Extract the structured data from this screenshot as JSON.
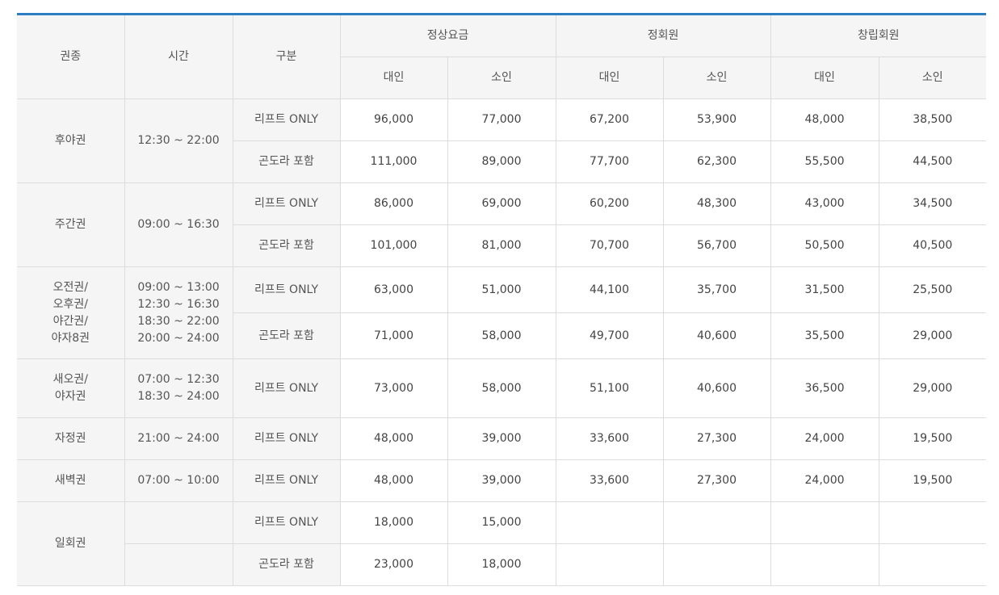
{
  "header": {
    "ticket": "권종",
    "time": "시간",
    "type": "구분",
    "groups": [
      "정상요금",
      "정회원",
      "창립회원"
    ],
    "adult": "대인",
    "child": "소인"
  },
  "rows": [
    {
      "ticket": "후야권",
      "time": "12:30 ~ 22:00",
      "type": "리프트 ONLY",
      "prices": [
        "96,000",
        "77,000",
        "67,200",
        "53,900",
        "48,000",
        "38,500"
      ]
    },
    {
      "type": "곤도라 포함",
      "prices": [
        "111,000",
        "89,000",
        "77,700",
        "62,300",
        "55,500",
        "44,500"
      ]
    },
    {
      "ticket": "주간권",
      "time": "09:00 ~ 16:30",
      "type": "리프트 ONLY",
      "prices": [
        "86,000",
        "69,000",
        "60,200",
        "48,300",
        "43,000",
        "34,500"
      ]
    },
    {
      "type": "곤도라 포함",
      "prices": [
        "101,000",
        "81,000",
        "70,700",
        "56,700",
        "50,500",
        "40,500"
      ]
    },
    {
      "ticket_lines": [
        "오전권/",
        "오후권/",
        "야간권/",
        "야자8권"
      ],
      "time_lines": [
        "09:00 ~ 13:00",
        "12:30 ~ 16:30",
        "18:30 ~ 22:00",
        "20:00 ~ 24:00"
      ],
      "type": "리프트 ONLY",
      "prices": [
        "63,000",
        "51,000",
        "44,100",
        "35,700",
        "31,500",
        "25,500"
      ]
    },
    {
      "type": "곤도라 포함",
      "prices": [
        "71,000",
        "58,000",
        "49,700",
        "40,600",
        "35,500",
        "29,000"
      ]
    },
    {
      "ticket_lines": [
        "새오권/",
        "야자권"
      ],
      "time_lines": [
        "07:00 ~ 12:30",
        "18:30 ~ 24:00"
      ],
      "type": "리프트 ONLY",
      "prices": [
        "73,000",
        "58,000",
        "51,100",
        "40,600",
        "36,500",
        "29,000"
      ]
    },
    {
      "ticket": "자정권",
      "time": "21:00 ~ 24:00",
      "type": "리프트 ONLY",
      "prices": [
        "48,000",
        "39,000",
        "33,600",
        "27,300",
        "24,000",
        "19,500"
      ]
    },
    {
      "ticket": "새벽권",
      "time": "07:00 ~ 10:00",
      "type": "리프트 ONLY",
      "prices": [
        "48,000",
        "39,000",
        "33,600",
        "27,300",
        "24,000",
        "19,500"
      ]
    },
    {
      "ticket": "일회권",
      "time": "",
      "type": "리프트 ONLY",
      "prices": [
        "18,000",
        "15,000",
        "",
        "",
        "",
        ""
      ]
    },
    {
      "time": "",
      "type": "곤도라 포함",
      "prices": [
        "23,000",
        "18,000",
        "",
        "",
        "",
        ""
      ]
    }
  ],
  "colors": {
    "accent_border": "#2b7ec1",
    "header_bg": "#f5f5f5",
    "grid_line": "#dcdcdc"
  }
}
